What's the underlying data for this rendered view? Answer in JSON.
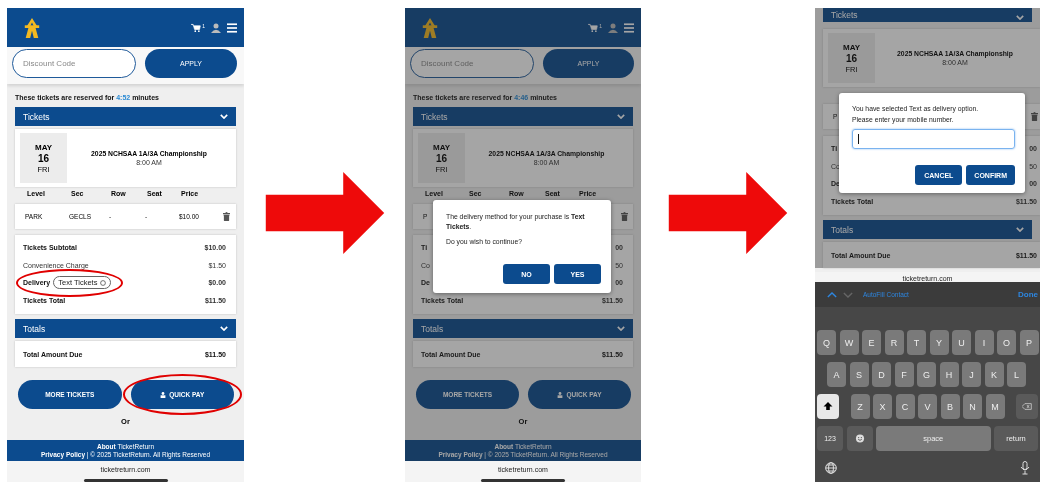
{
  "panels": [
    {
      "kind": "checkout",
      "dimmed": false,
      "header": {
        "cart_count": "1"
      },
      "discount": {
        "placeholder": "Discount Code",
        "button": "APPLY"
      },
      "reservation": {
        "before": "These tickets are reserved for",
        "time": "4:52",
        "after": "minutes"
      },
      "tickets_section": {
        "title": "Tickets"
      },
      "event": {
        "month": "MAY",
        "day": "16",
        "weekday": "FRI",
        "title": "2025 NCHSAA 1A/3A Championship",
        "time": "8:00 AM"
      },
      "columns": [
        "Level",
        "Sec",
        "Row",
        "Seat",
        "Price"
      ],
      "row": {
        "cells": [
          "PARK",
          "GECLS",
          "-",
          "-",
          "$10.00"
        ]
      },
      "summary": [
        {
          "kind": "line",
          "label": "Tickets Subtotal",
          "amount": "$10.00",
          "bold": true
        },
        {
          "kind": "line",
          "label": "Convenience Charge",
          "amount": "$1.50",
          "bold": false
        },
        {
          "kind": "select",
          "label": "Delivery",
          "value": "Text Tickets",
          "amount": "$0.00",
          "circled": true
        },
        {
          "kind": "line",
          "label": "Tickets Total",
          "amount": "$11.50",
          "bold": true
        }
      ],
      "totals_section": {
        "title": "Totals"
      },
      "total_due": {
        "label": "Total Amount Due",
        "amount": "$11.50"
      },
      "buttons": [
        {
          "label": "MORE TICKETS",
          "kind": "plain",
          "circled": false
        },
        {
          "label": "QUICK PAY",
          "kind": "profile",
          "circled": true
        }
      ],
      "or": "Or",
      "footer": {
        "about": "**About** TicketReturn",
        "legal": "**Privacy Policy** | © 2025 TicketReturn. All Rights Reserved"
      },
      "url": "ticketreturn.com"
    },
    {
      "kind": "checkout",
      "dimmed": true,
      "header": {
        "cart_count": "1"
      },
      "discount": {
        "placeholder": "Discount Code",
        "button": "APPLY"
      },
      "reservation": {
        "before": "These tickets are reserved for",
        "time": "4:46",
        "after": "minutes"
      },
      "tickets_section": {
        "title": "Tickets"
      },
      "event": {
        "month": "MAY",
        "day": "16",
        "weekday": "FRI",
        "title": "2025 NCHSAA 1A/3A Championship",
        "time": "8:00 AM"
      },
      "columns": [
        "Level",
        "Sec",
        "Row",
        "Seat",
        "Price"
      ],
      "row": {
        "cells": [
          "P"
        ]
      },
      "summary": [
        {
          "kind": "line",
          "label": "Ti",
          "amount": "00",
          "bold": true
        },
        {
          "kind": "line",
          "label": "Co",
          "amount": "50",
          "bold": false
        },
        {
          "kind": "line",
          "label": "De",
          "amount": "00",
          "bold": true
        },
        {
          "kind": "line",
          "label": "Tickets Total",
          "amount": "$11.50",
          "bold": true
        }
      ],
      "totals_section": {
        "title": "Totals"
      },
      "total_due": {
        "label": "Total Amount Due",
        "amount": "$11.50"
      },
      "buttons": [
        {
          "label": "MORE TICKETS",
          "kind": "plain",
          "circled": false
        },
        {
          "label": "QUICK PAY",
          "kind": "profile",
          "circled": false
        }
      ],
      "or": "Or",
      "footer": {
        "about": "**About** TicketReturn",
        "legal": "**Privacy Policy** | © 2025 TicketReturn. All Rights Reserved"
      },
      "url": "ticketreturn.com",
      "dialog": {
        "kind": "confirm",
        "message": "The delivery method for your purchase is **Text Tickets**.",
        "question": "Do you wish to continue?",
        "buttons": [
          "NO",
          "YES"
        ]
      }
    },
    {
      "kind": "keyboard",
      "dimmed": true,
      "tickets_section": {
        "title": "Tickets"
      },
      "event": {
        "month": "MAY",
        "day": "16",
        "weekday": "FRI",
        "title": "2025 NCHSAA 1A/3A Championship",
        "time": "8:00 AM"
      },
      "row": {
        "cells": [
          "P"
        ]
      },
      "summary": [
        {
          "kind": "line",
          "label": "Ti",
          "amount": "00",
          "bold": true
        },
        {
          "kind": "line",
          "label": "Co",
          "amount": "50",
          "bold": false
        },
        {
          "kind": "line",
          "label": "De",
          "amount": "00",
          "bold": true
        },
        {
          "kind": "line",
          "label": "Tickets Total",
          "amount": "$11.50",
          "bold": true
        }
      ],
      "totals_section": {
        "title": "Totals"
      },
      "total_due": {
        "label": "Total Amount Due",
        "amount": "$11.50"
      },
      "url": "ticketreturn.com",
      "dialog": {
        "kind": "prompt",
        "message": "You have selected Text as delivery option.",
        "question": "Please enter your mobile number.",
        "focused": true,
        "buttons": [
          "CANCEL",
          "CONFIRM"
        ]
      },
      "keyboard": {
        "autofill": "AutoFill Contact",
        "done": "Done",
        "rows": [
          [
            "Q",
            "W",
            "E",
            "R",
            "T",
            "Y",
            "U",
            "I",
            "O",
            "P"
          ],
          [
            "A",
            "S",
            "D",
            "F",
            "G",
            "H",
            "J",
            "K",
            "L"
          ],
          [
            "Z",
            "X",
            "C",
            "V",
            "B",
            "N",
            "M"
          ]
        ],
        "numbers": "123",
        "space": "space",
        "return": "return"
      }
    }
  ]
}
